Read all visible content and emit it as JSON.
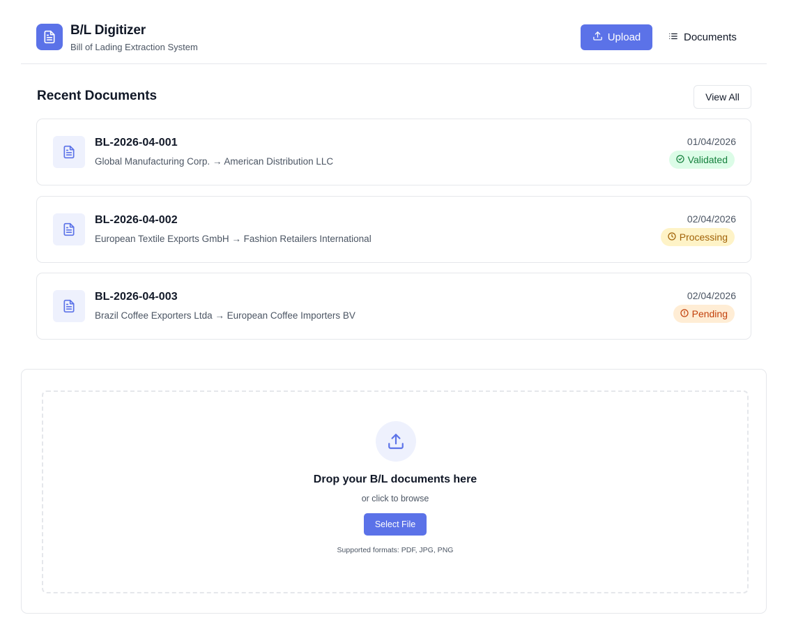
{
  "app": {
    "title": "B/L Digitizer",
    "subtitle": "Bill of Lading Extraction System",
    "logo_icon": "document-icon"
  },
  "nav": {
    "upload_label": "Upload",
    "upload_icon": "upload-icon",
    "documents_label": "Documents",
    "documents_icon": "list-icon"
  },
  "recent": {
    "title": "Recent Documents",
    "view_all_label": "View All",
    "documents": [
      {
        "id": "BL-2026-04-001",
        "parties": "Global Manufacturing Corp. → American Distribution LLC",
        "date": "01/04/2026",
        "status": "Validated",
        "status_icon": "check-circle-icon"
      },
      {
        "id": "BL-2026-04-002",
        "parties": "European Textile Exports GmbH → Fashion Retailers International",
        "date": "02/04/2026",
        "status": "Processing",
        "status_icon": "clock-icon"
      },
      {
        "id": "BL-2026-04-003",
        "parties": "Brazil Coffee Exporters Ltda → European Coffee Importers BV",
        "date": "02/04/2026",
        "status": "Pending",
        "status_icon": "alert-circle-icon"
      }
    ]
  },
  "dropzone": {
    "title": "Drop your B/L documents here",
    "subtitle": "or click to browse",
    "button_label": "Select File",
    "formats": "Supported formats: PDF, JPG, PNG",
    "icon": "upload-icon"
  },
  "colors": {
    "accent": "#5b72e8",
    "validated_bg": "#dcfce7",
    "validated_text": "#15803d",
    "processing_bg": "#fef3c7",
    "processing_text": "#a16207",
    "pending_bg": "#ffedd5",
    "pending_text": "#c2410c"
  }
}
